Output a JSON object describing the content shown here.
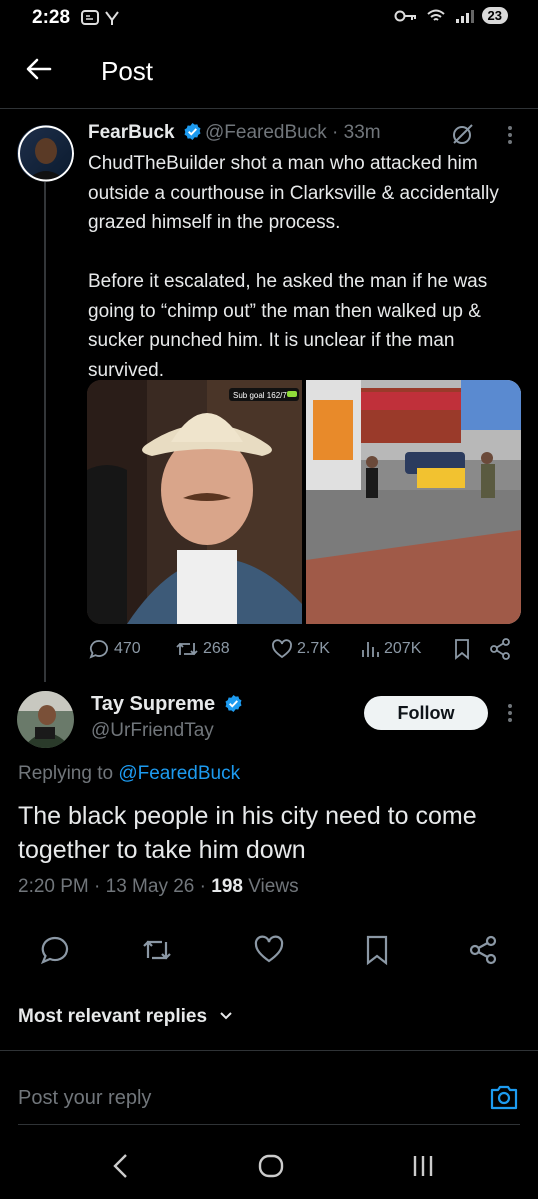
{
  "status_bar": {
    "time": "2:28",
    "battery": "23"
  },
  "header": {
    "title": "Post"
  },
  "quoted_post": {
    "name": "FearBuck",
    "handle": "@FearedBuck",
    "separator": "·",
    "age": "33m",
    "text": "ChudTheBuilder shot a man who attacked him outside a courthouse in Clarksville & accidentally grazed himself in the process.\n\nBefore it escalated, he asked the man if he was going to “chimp out” the man then walked up & sucker punched him. It is unclear if the man survived.",
    "media_overlay": "Sub goal 162/7",
    "stats": {
      "replies": "470",
      "reposts": "268",
      "likes": "2.7K",
      "views": "207K"
    }
  },
  "main_post": {
    "name": "Tay Supreme",
    "handle": "@UrFriendTay",
    "follow_label": "Follow",
    "replying_prefix": "Replying to ",
    "replying_handle": "@FearedBuck",
    "text": "The black people in his city need to come together to take him down",
    "time": "2:20 PM · 13 May 26 · ",
    "views_count": "198",
    "views_label": " Views"
  },
  "replies_sort": {
    "label": "Most relevant replies"
  },
  "composer": {
    "placeholder": "Post your reply"
  },
  "colors": {
    "accent": "#1d9bf0",
    "background": "#000000",
    "secondary_text": "#71767b"
  },
  "icons": [
    "back-arrow-icon",
    "verified-icon",
    "grok-icon",
    "more-icon",
    "reply-icon",
    "repost-icon",
    "like-icon",
    "views-icon",
    "bookmark-icon",
    "share-icon",
    "chevron-down-icon",
    "camera-icon",
    "nav-back-icon",
    "nav-home-icon",
    "nav-recents-icon"
  ]
}
